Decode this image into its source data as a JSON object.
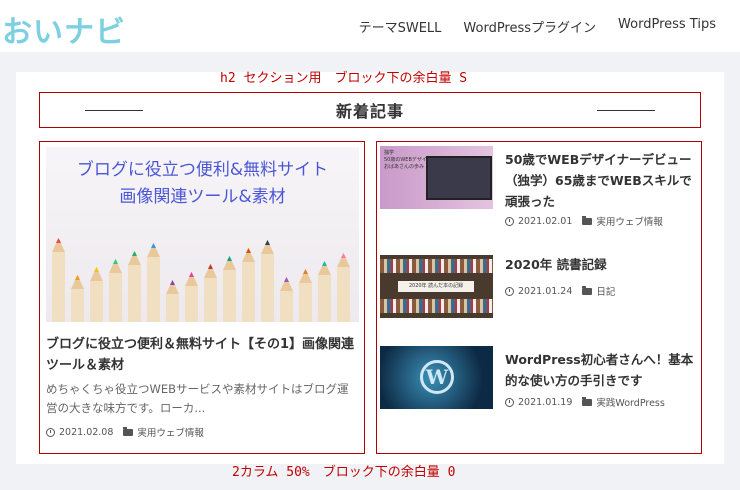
{
  "header": {
    "logo": "おいナビ",
    "nav": [
      "テーマSWELL",
      "WordPressプラグイン",
      "WordPress Tips"
    ]
  },
  "annotations": {
    "top": "h2 セクション用　ブロック下の余白量 S",
    "bottom": "2カラム 50%　ブロック下の余白量 0"
  },
  "section": {
    "heading": "新着記事"
  },
  "featured": {
    "thumb_line1": "ブログに役立つ便利&無料サイト",
    "thumb_line2": "画像関連ツール&素材",
    "title": "ブログに役立つ便利＆無料サイト【その1】画像関連ツール＆素材",
    "excerpt": "めちゃくちゃ役立つWEBサービスや素材サイトはブログ運営の大きな味方です。ローカ...",
    "date": "2021.02.08",
    "category": "実用ウェブ情報"
  },
  "posts": [
    {
      "title": "50歳でWEBデザイナーデビュー（独学）65歳までWEBスキルで頑張った",
      "date": "2021.02.01",
      "category": "実用ウェブ情報",
      "thumb_text": "独学\n50歳のWEBデザイナー\nおばあさんの歩み"
    },
    {
      "title": "2020年 読書記録",
      "date": "2021.01.24",
      "category": "日記",
      "thumb_text": "2020年 読んだ本の記録"
    },
    {
      "title": "WordPress初心者さんへ！基本的な使い方の手引きです",
      "date": "2021.01.19",
      "category": "実践WordPress",
      "thumb_text": "W"
    }
  ],
  "colors": {
    "logo": "#7dd0e0",
    "annotation": "#c00000",
    "frame_border": "#b00000",
    "thumb_heading": "#4a56d6",
    "background": "#f0f2f5"
  }
}
